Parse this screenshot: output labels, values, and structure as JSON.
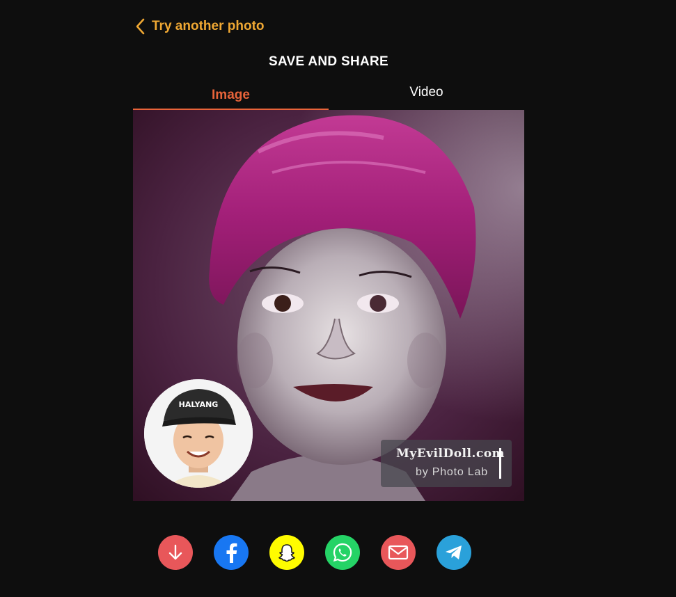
{
  "nav": {
    "back_label": "Try another photo"
  },
  "header": {
    "title": "SAVE AND SHARE"
  },
  "tabs": [
    {
      "label": "Image",
      "active": true
    },
    {
      "label": "Video",
      "active": false
    }
  ],
  "result": {
    "watermark_brand": "MyEvilDoll.com",
    "watermark_sub": "by Photo Lab"
  },
  "share": [
    {
      "icon": "download-icon",
      "color": "#e8575a"
    },
    {
      "icon": "facebook-icon",
      "color": "#1877f2"
    },
    {
      "icon": "snapchat-icon",
      "color": "#fffc00"
    },
    {
      "icon": "whatsapp-icon",
      "color": "#25d366"
    },
    {
      "icon": "email-icon",
      "color": "#e8575a"
    },
    {
      "icon": "telegram-icon",
      "color": "#2aa1da"
    }
  ],
  "colors": {
    "background": "#0e0e0e",
    "accent_back": "#f0a833",
    "accent_tab": "#e8643a"
  }
}
